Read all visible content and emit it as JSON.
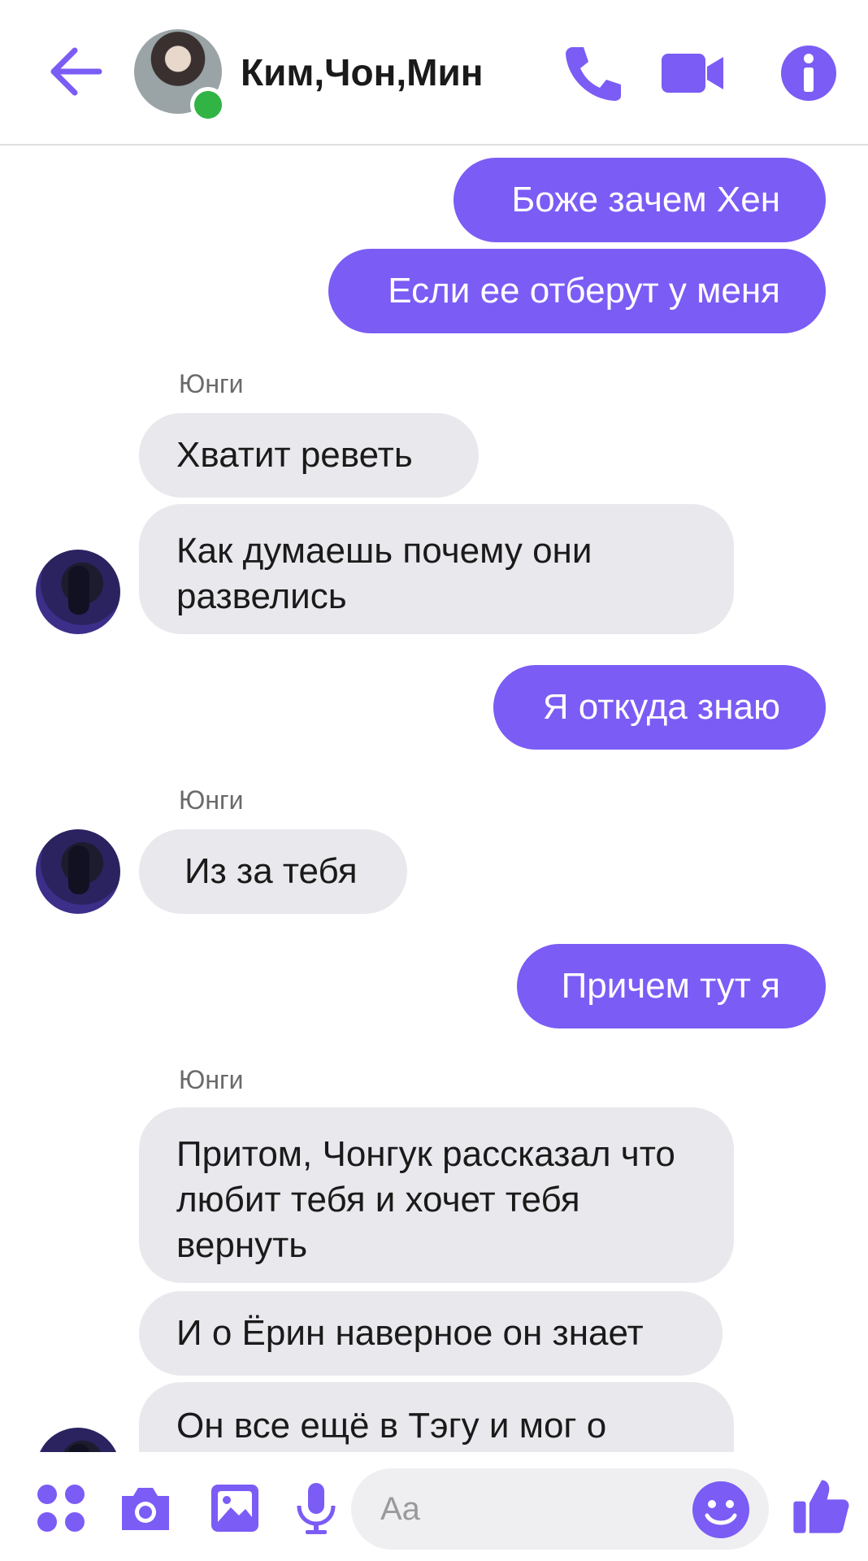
{
  "header": {
    "title": "Ким,Чон,Мин",
    "icons": [
      "back-arrow-icon",
      "phone-icon",
      "video-icon",
      "info-icon"
    ]
  },
  "colors": {
    "accent": "#7b5cf5",
    "incoming_bubble": "#e9e8ec",
    "online": "#31b443"
  },
  "messages": {
    "m1": "Боже зачем Хен",
    "m2": "Если ее отберут у меня",
    "sender1": "Юнги",
    "m3": "Хватит реветь",
    "m4": "Как думаешь почему они развелись",
    "m5": "Я откуда знаю",
    "sender2": "Юнги",
    "m6": "Из за тебя",
    "m7": "Причем тут я",
    "sender3": "Юнги",
    "m8": "Притом, Чонгук рассказал что любит тебя и хочет тебя вернуть",
    "m9": "И о Ёрин наверное он знает",
    "m10": "Он все ещё в Тэгу и мог о"
  },
  "composer": {
    "placeholder": "Aa",
    "icons": [
      "apps-icon",
      "camera-icon",
      "gallery-icon",
      "microphone-icon",
      "emoji-icon",
      "thumbs-up-icon"
    ]
  }
}
